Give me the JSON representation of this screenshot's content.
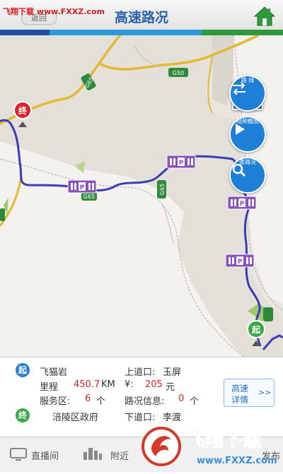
{
  "header": {
    "watermark": "飞翔下载 www.FXXZ.com",
    "back_label": "返回",
    "title": "高速路况",
    "home_icon": "home-icon"
  },
  "map": {
    "road_labels": [
      "G65",
      "G50",
      "G65",
      "G65"
    ],
    "start_marker": "起",
    "end_marker": "终",
    "buttons": {
      "route_label": "路  线",
      "video_label": "视频截图",
      "search_label": "查路况"
    },
    "route_color": "#3a3cb5"
  },
  "info": {
    "start_badge": "起",
    "start_name": "飞猫岩",
    "entry_label": "上道口:",
    "entry_value": "玉屏",
    "mileage_label": "里程",
    "mileage_value": "450.7",
    "mileage_unit": "KM",
    "fee_label": "¥:",
    "fee_value": "205",
    "fee_unit": "元",
    "service_label": "服务区:",
    "service_value": "6",
    "service_unit": "个",
    "traffic_label": "路况信息:",
    "traffic_value": "0",
    "traffic_unit": "个",
    "detail_line1": "高速",
    "detail_line2": "详情",
    "detail_arrow": ">>",
    "end_badge": "终",
    "end_name": "涪陵区政府",
    "exit_label": "下道口:",
    "exit_value": "李渡"
  },
  "tabs": [
    {
      "label": "直播间",
      "icon": "monitor-icon"
    },
    {
      "label": "附近",
      "icon": "city-icon"
    },
    {
      "label": "发布",
      "icon": "publish-icon"
    }
  ],
  "watermark_bottom": {
    "main": "飞翔下载",
    "url": "www.FXXZ.com"
  }
}
